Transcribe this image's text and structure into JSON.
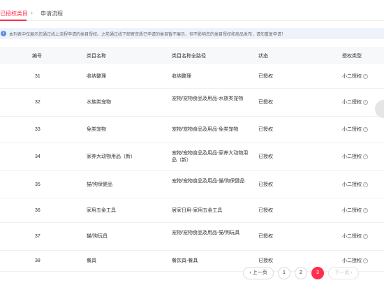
{
  "tabs": {
    "active": "已授权类目",
    "separator": "›",
    "inactive": "申请流程"
  },
  "notice": {
    "icon": "info-icon",
    "text": "本列表中仅展示您通过线上流程申请的类目授权。之前通过线下邮寄资质已申请的类目暂不展示，但不影响您的类目授权和商品发布，请勿重复申请！"
  },
  "table": {
    "headers": [
      "编号",
      "类目名称",
      "类目名称全路径",
      "状态",
      "授权类型"
    ],
    "rows": [
      {
        "id": "31",
        "name": "收纳整理",
        "path": "收纳整理",
        "status": "已授权",
        "type": "小二授权"
      },
      {
        "id": "32",
        "name": "水族类宠物",
        "path": "宠物/宠物食品及用品-水族类宠物",
        "status": "已授权",
        "type": "小二授权"
      },
      {
        "id": "33",
        "name": "免类宠物",
        "path": "宠物/宠物食品及用品-免类宠物",
        "status": "已授权",
        "type": "小二授权"
      },
      {
        "id": "34",
        "name": "家养大动物用品（新）",
        "path": "宠物/宠物食品及用品-家养大动物用品（新）",
        "status": "已授权",
        "type": "小二授权"
      },
      {
        "id": "35",
        "name": "猫/狗保健品",
        "path": "宠物/宠物食品及用品-猫/狗保健品",
        "status": "已授权",
        "type": "小二授权"
      },
      {
        "id": "36",
        "name": "家用五金工具",
        "path": "居家日用-家用五金工具",
        "status": "已授权",
        "type": "小二授权"
      },
      {
        "id": "37",
        "name": "猫/狗玩具",
        "path": "宠物/宠物食品及用品-猫/狗玩具",
        "status": "已授权",
        "type": "小二授权"
      },
      {
        "id": "38",
        "name": "餐具",
        "path": "餐饮具-餐具",
        "status": "已授权",
        "type": "小二授权"
      }
    ]
  },
  "pagination": {
    "prev": "‹ 上一页",
    "pages": [
      "1",
      "2",
      "3"
    ],
    "current": "3",
    "next": "下一页 ›"
  },
  "colors": {
    "accent": "#ff2e4d",
    "notice_bg": "#eef3fb",
    "header_bg": "#f7f8fa"
  }
}
